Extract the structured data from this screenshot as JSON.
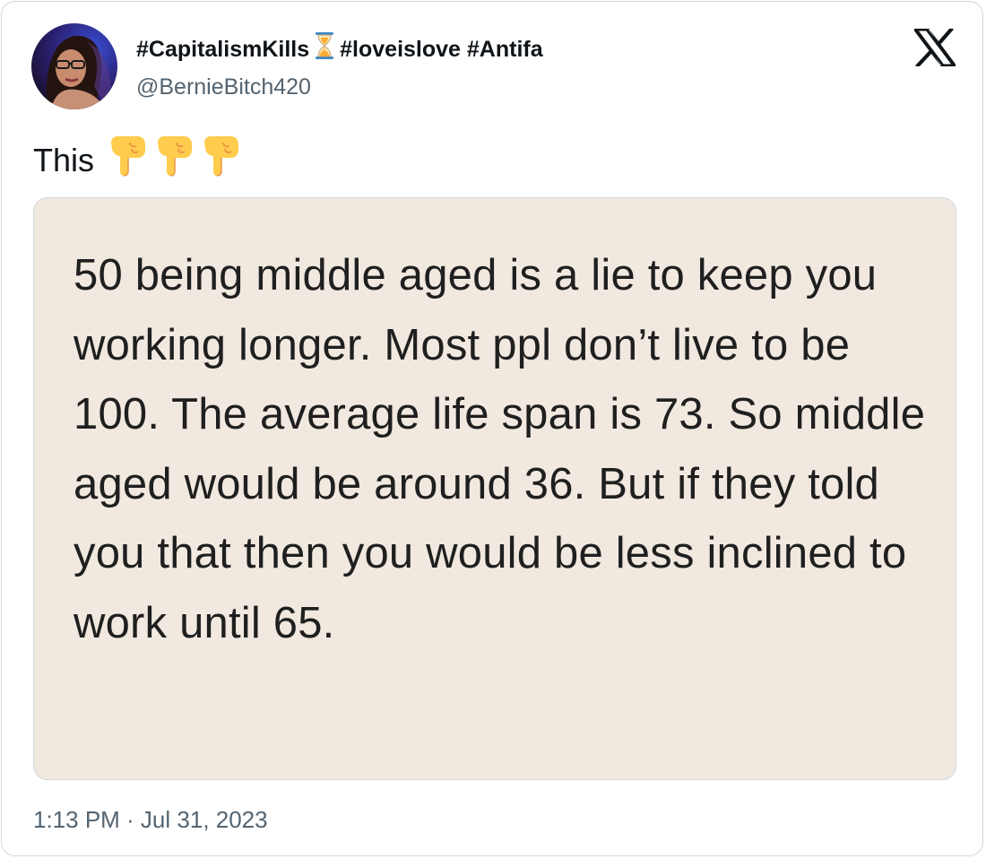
{
  "tweet": {
    "display_name_parts": [
      "#CapitalismKills",
      "#loveislove #Antifa"
    ],
    "display_name_emoji": "hourglass-icon",
    "handle": "@BernieBitch420",
    "text": "This",
    "text_emojis": [
      "pointing-down-icon",
      "pointing-down-icon",
      "pointing-down-icon"
    ],
    "timestamp": "1:13 PM · Jul 31, 2023"
  },
  "media": {
    "text": "50 being middle aged is a lie to keep you working longer. Most ppl don’t live to be 100. The average life span is 73. So middle aged would be around 36. But if they told you that then you would be less inclined to work until 65.",
    "background": "#f1e8df"
  },
  "brand": {
    "logo": "x-logo-icon"
  },
  "colors": {
    "text": "#0f1419",
    "secondary": "#536471",
    "border": "#cfd9de"
  }
}
